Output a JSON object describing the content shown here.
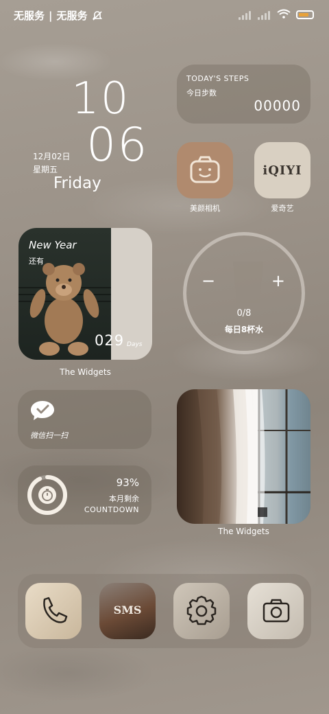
{
  "status_bar": {
    "carrier1": "无服务",
    "separator": "|",
    "carrier2": "无服务"
  },
  "clock": {
    "hour": "10",
    "minute": "06",
    "date": "12月02日",
    "weekday_cn": "星期五",
    "weekday_en": "Friday"
  },
  "steps_widget": {
    "title": "TODAY'S STEPS",
    "subtitle": "今日步数",
    "count": "00000"
  },
  "apps": [
    {
      "label": "美颜相机",
      "icon": "camera-smile-icon",
      "color": "#b08a6e"
    },
    {
      "label": "爱奇艺",
      "icon": "iqiyi-logo",
      "logo_text": "iQIYI",
      "color": "#d9d0c2"
    }
  ],
  "bear_widget": {
    "title": "New Year",
    "subtitle": "还有",
    "days": "029",
    "days_unit": "Days",
    "caption": "The Widgets"
  },
  "water_widget": {
    "minus": "−",
    "plus": "+",
    "progress": "0/8",
    "label": "每日8杯水",
    "cups_done": 0,
    "cups_total": 8
  },
  "wechat_widget": {
    "label": "微信扫一扫",
    "icon": "wechat-scan-icon"
  },
  "countdown_widget": {
    "percent": "93%",
    "label_cn": "本月剩余",
    "label_en": "COUNTDOWN",
    "fraction": 0.93
  },
  "curtain_widget": {
    "caption": "The Widgets"
  },
  "dock": [
    {
      "name": "phone",
      "icon": "phone-icon"
    },
    {
      "name": "sms",
      "icon": "sms-icon",
      "text": "SMS"
    },
    {
      "name": "settings",
      "icon": "gear-icon"
    },
    {
      "name": "camera",
      "icon": "camera-icon"
    }
  ]
}
